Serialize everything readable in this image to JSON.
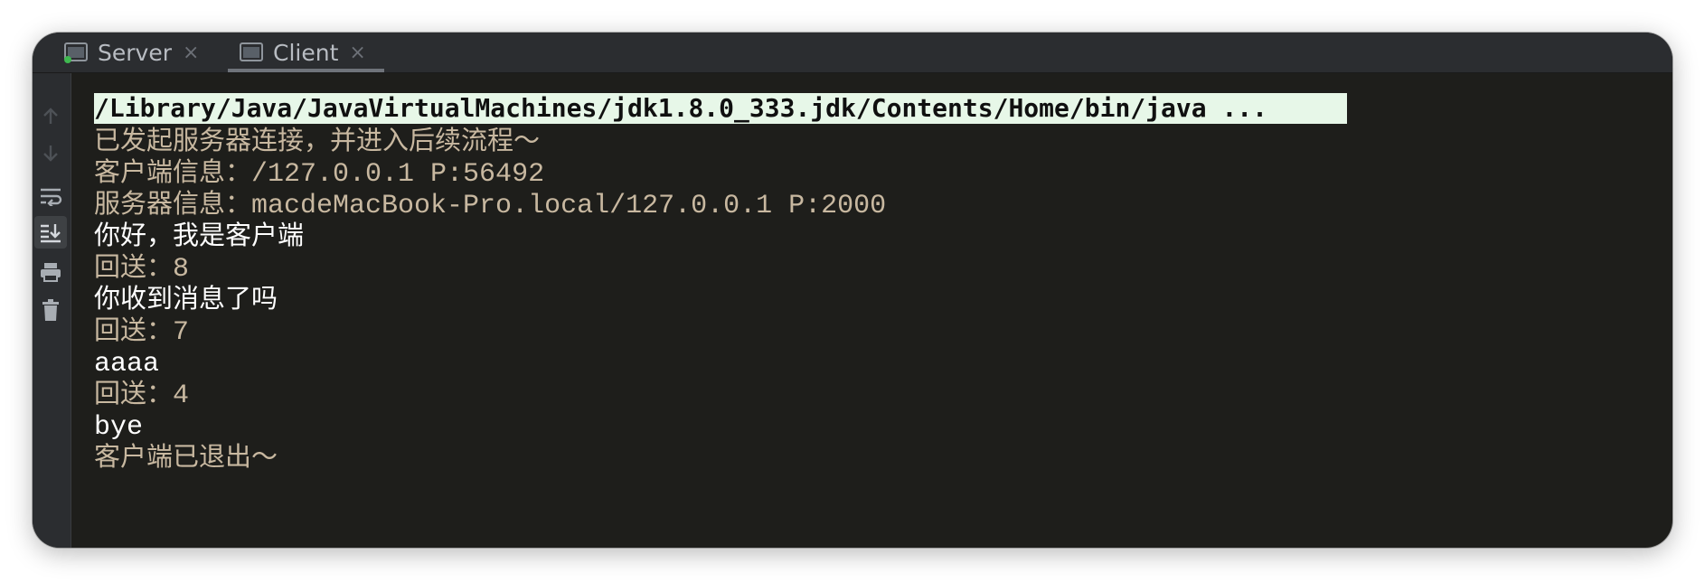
{
  "tabs": [
    {
      "label": "Server",
      "active": false,
      "icon": "console-icon",
      "status_color": "#3fb950"
    },
    {
      "label": "Client",
      "active": true,
      "icon": "console-icon"
    }
  ],
  "close_glyph": "×",
  "gutter_icons": [
    "up-arrow-icon",
    "down-arrow-icon",
    "soft-wrap-icon",
    "scroll-to-end-icon",
    "print-icon",
    "trash-icon"
  ],
  "console": {
    "command": "/Library/Java/JavaVirtualMachines/jdk1.8.0_333.jdk/Contents/Home/bin/java ...",
    "lines": [
      {
        "style": "sys",
        "cjk": "已发起服务器连接，并进入后续流程～",
        "mono": ""
      },
      {
        "style": "sys",
        "cjk": "客户端信息：",
        "mono": "/127.0.0.1 P:56492"
      },
      {
        "style": "sys",
        "cjk": "服务器信息：",
        "mono": "macdeMacBook-Pro.local/127.0.0.1 P:2000"
      },
      {
        "style": "usr",
        "cjk": "你好，我是客户端",
        "mono": ""
      },
      {
        "style": "sys",
        "cjk": "回送：",
        "mono": "8"
      },
      {
        "style": "usr",
        "cjk": "你收到消息了吗",
        "mono": ""
      },
      {
        "style": "sys",
        "cjk": "回送：",
        "mono": "7"
      },
      {
        "style": "usr",
        "cjk": "",
        "mono": "aaaa"
      },
      {
        "style": "sys",
        "cjk": "回送：",
        "mono": "4"
      },
      {
        "style": "usr",
        "cjk": "",
        "mono": "bye"
      },
      {
        "style": "sys",
        "cjk": "客户端已退出～",
        "mono": ""
      }
    ]
  },
  "colors": {
    "background": "#1e1e1b",
    "system_text": "#c8b8a0",
    "user_text": "#ffffff",
    "command_highlight": "#e7f7e8"
  }
}
